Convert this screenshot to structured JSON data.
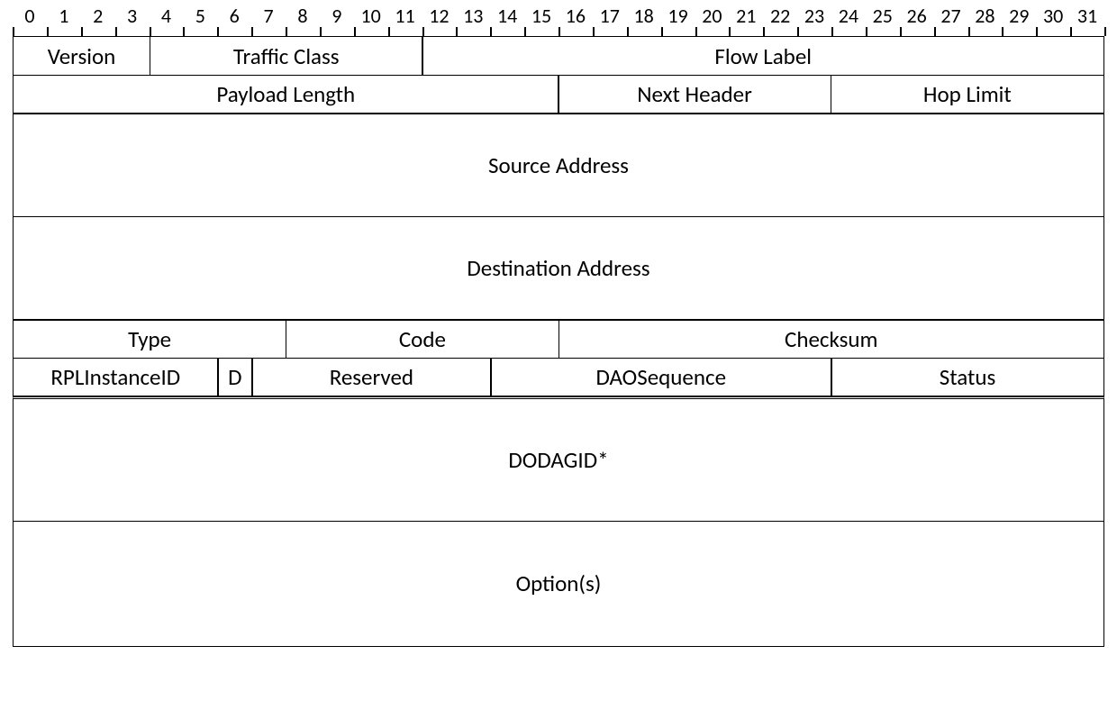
{
  "ruler": {
    "bits": 32,
    "labels": [
      "0",
      "1",
      "2",
      "3",
      "4",
      "5",
      "6",
      "7",
      "8",
      "9",
      "10",
      "11",
      "12",
      "13",
      "14",
      "15",
      "16",
      "17",
      "18",
      "19",
      "20",
      "21",
      "22",
      "23",
      "24",
      "25",
      "26",
      "27",
      "28",
      "29",
      "30",
      "31"
    ]
  },
  "rows": [
    {
      "height": "h-normal",
      "cells": [
        {
          "label": "Version",
          "bits": 4
        },
        {
          "label": "Traffic Class",
          "bits": 8
        },
        {
          "label": "Flow Label",
          "bits": 20
        }
      ]
    },
    {
      "height": "h-normal",
      "cells": [
        {
          "label": "Payload Length",
          "bits": 16
        },
        {
          "label": "Next Header",
          "bits": 8
        },
        {
          "label": "Hop Limit",
          "bits": 8
        }
      ]
    },
    {
      "height": "h-big",
      "cells": [
        {
          "label": "Source Address",
          "bits": 32
        }
      ]
    },
    {
      "height": "h-big",
      "cells": [
        {
          "label": "Destination Address",
          "bits": 32
        }
      ]
    },
    {
      "height": "h-normal",
      "cells": [
        {
          "label": "Type",
          "bits": 8
        },
        {
          "label": "Code",
          "bits": 8
        },
        {
          "label": "Checksum",
          "bits": 16
        }
      ]
    },
    {
      "height": "h-normal",
      "cells": [
        {
          "label": "RPLInstanceID",
          "bits": 6
        },
        {
          "label": "D",
          "bits": 1
        },
        {
          "label": "Reserved",
          "bits": 7
        },
        {
          "label": "DAOSequence",
          "bits": 10
        },
        {
          "label": "Status",
          "bits": 8
        }
      ]
    },
    {
      "height": "h-biggest",
      "doubleTop": true,
      "cells": [
        {
          "label": "DODAGID*",
          "bits": 32
        }
      ]
    },
    {
      "height": "h-biggest",
      "cells": [
        {
          "label": "Option(s)",
          "bits": 32
        }
      ]
    }
  ]
}
